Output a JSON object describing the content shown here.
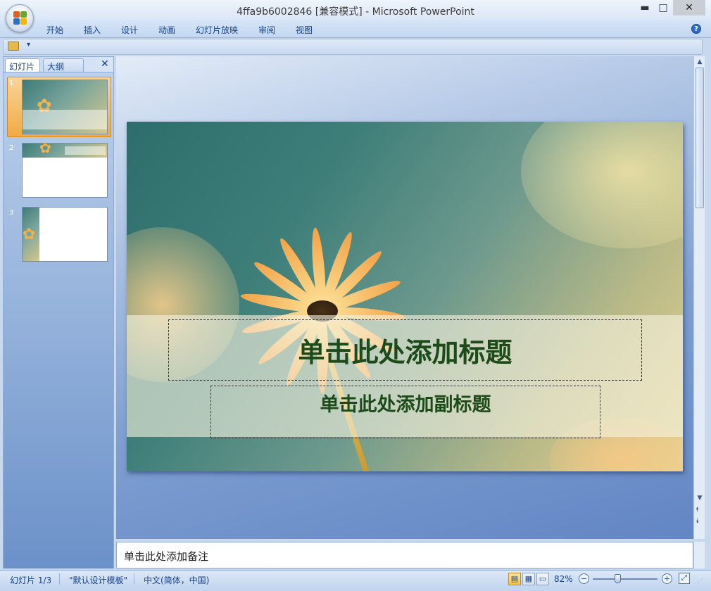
{
  "window": {
    "title": "4ffa9b6002846 [兼容模式] - Microsoft PowerPoint",
    "minimize": "▬",
    "maximize": "□",
    "close": "✕"
  },
  "ribbon": {
    "tabs": [
      "开始",
      "插入",
      "设计",
      "动画",
      "幻灯片放映",
      "审阅",
      "视图"
    ],
    "help": "?"
  },
  "qat": {
    "dropdown": "▾"
  },
  "slides_pane": {
    "tab_slides": "幻灯片",
    "tab_outline": "大纲",
    "close": "✕",
    "thumbnails": [
      {
        "number": "1",
        "selected": true
      },
      {
        "number": "2",
        "selected": false
      },
      {
        "number": "3",
        "selected": false
      }
    ]
  },
  "slide": {
    "title_placeholder": "单击此处添加标题",
    "subtitle_placeholder": "单击此处添加副标题"
  },
  "notes": {
    "placeholder": "单击此处添加备注"
  },
  "scrollbar": {
    "up": "▲",
    "down": "▼",
    "prev_slide": "⯭",
    "next_slide": "⯯"
  },
  "status": {
    "slide_counter": "幻灯片 1/3",
    "theme": "\"默认设计模板\"",
    "language": "中文(简体，中国)",
    "zoom": "82%",
    "zoom_out": "−",
    "zoom_in": "+"
  },
  "colors": {
    "ribbon": "#c2d7f1",
    "placeholder_text": "#1d4a19",
    "selected_thumb": "#f2aa45"
  }
}
